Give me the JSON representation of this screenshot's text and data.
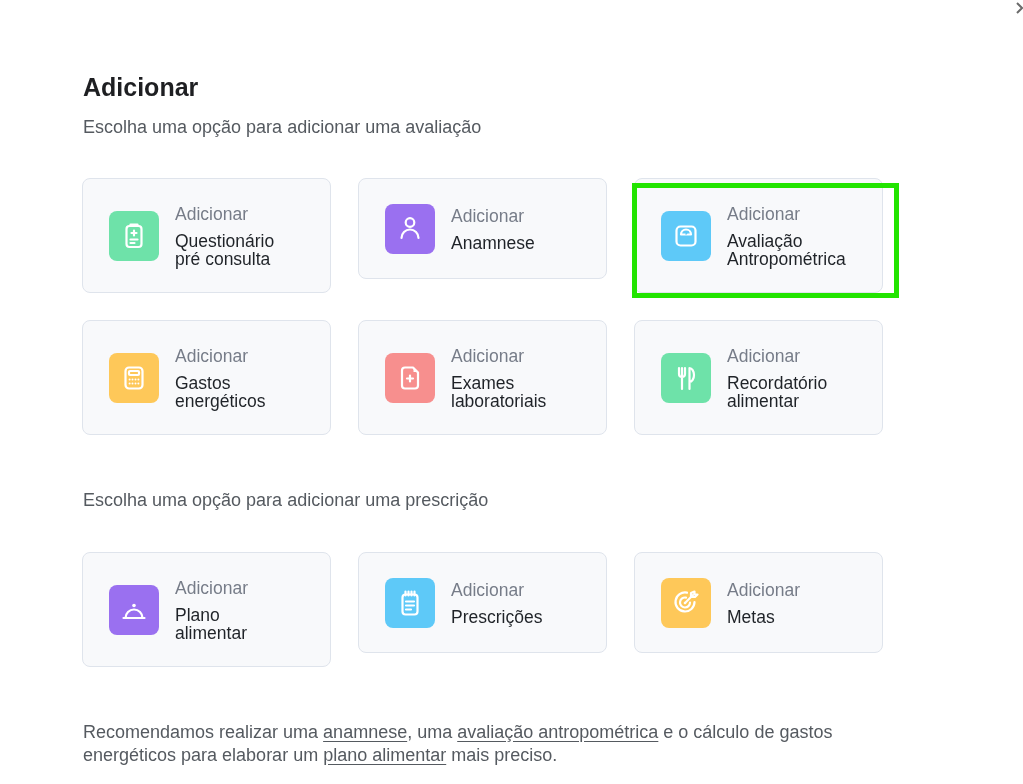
{
  "title": "Adicionar",
  "sections": [
    {
      "heading": "Escolha uma opção para adicionar uma avaliação",
      "cards": [
        {
          "label": "Adicionar",
          "title": "Questionário\npré consulta",
          "color": "#6ee2a9",
          "highlighted": false
        },
        {
          "label": "Adicionar",
          "title": "Anamnese",
          "color": "#9a70f0",
          "highlighted": false
        },
        {
          "label": "Adicionar",
          "title": "Avaliação\nAntropométrica",
          "color": "#5ec9f8",
          "highlighted": true
        },
        {
          "label": "Adicionar",
          "title": "Gastos\nenergéticos",
          "color": "#fec859",
          "highlighted": false
        },
        {
          "label": "Adicionar",
          "title": "Exames\nlaboratoriais",
          "color": "#f78f8e",
          "highlighted": false
        },
        {
          "label": "Adicionar",
          "title": "Recordatório\nalimentar",
          "color": "#6ee2a9",
          "highlighted": false
        }
      ]
    },
    {
      "heading": "Escolha uma opção para adicionar uma prescrição",
      "cards": [
        {
          "label": "Adicionar",
          "title": "Plano\nalimentar",
          "color": "#9a70f0",
          "highlighted": false
        },
        {
          "label": "Adicionar",
          "title": "Prescrições",
          "color": "#5ec9f8",
          "highlighted": false
        },
        {
          "label": "Adicionar",
          "title": "Metas",
          "color": "#fec859",
          "highlighted": false
        }
      ]
    }
  ],
  "note": [
    {
      "kind": "text",
      "text": "Recomendamos realizar uma "
    },
    {
      "kind": "link",
      "text": "anamnese"
    },
    {
      "kind": "text",
      "text": ", uma "
    },
    {
      "kind": "link",
      "text": "avaliação antropométrica"
    },
    {
      "kind": "text",
      "text": " e o cálculo de gastos energéticos para elaborar um "
    },
    {
      "kind": "link",
      "text": "plano alimentar"
    },
    {
      "kind": "text",
      "text": " mais preciso."
    }
  ]
}
